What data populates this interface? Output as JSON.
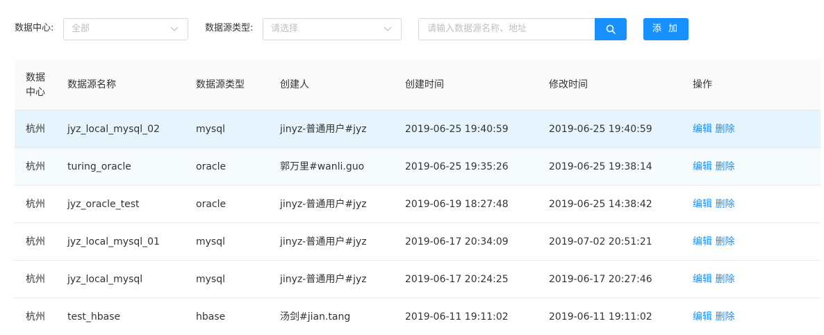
{
  "filters": {
    "datacenter_label": "数据中心:",
    "datacenter_placeholder": "全部",
    "type_label": "数据源类型:",
    "type_placeholder": "请选择",
    "search_placeholder": "请输入数据源名称、地址",
    "add_label": "添 加"
  },
  "icons": {
    "chevron": "chevron-down-icon",
    "search": "search-icon"
  },
  "colors": {
    "primary": "#1890ff",
    "selected_row": "#e6f4fd",
    "header_bg": "#fafafa"
  },
  "table": {
    "columns": [
      "数据中心",
      "数据源名称",
      "数据源类型",
      "创建人",
      "创建时间",
      "修改时间",
      "操作"
    ],
    "rows": [
      {
        "center": "杭州",
        "name": "jyz_local_mysql_02",
        "type": "mysql",
        "creator": "jinyz-普通用户#jyz",
        "created": "2019-06-25 19:40:59",
        "modified": "2019-06-25 19:40:59",
        "edit": "编辑",
        "del": "删除"
      },
      {
        "center": "杭州",
        "name": "turing_oracle",
        "type": "oracle",
        "creator": "郭万里#wanli.guo",
        "created": "2019-06-25 19:35:26",
        "modified": "2019-06-25 19:38:14",
        "edit": "编辑",
        "del": "删除"
      },
      {
        "center": "杭州",
        "name": "jyz_oracle_test",
        "type": "oracle",
        "creator": "jinyz-普通用户#jyz",
        "created": "2019-06-19 18:27:48",
        "modified": "2019-06-25 14:38:42",
        "edit": "编辑",
        "del": "删除"
      },
      {
        "center": "杭州",
        "name": "jyz_local_mysql_01",
        "type": "mysql",
        "creator": "jinyz-普通用户#jyz",
        "created": "2019-06-17 20:34:09",
        "modified": "2019-07-02 20:51:21",
        "edit": "编辑",
        "del": "删除"
      },
      {
        "center": "杭州",
        "name": "jyz_local_mysql",
        "type": "mysql",
        "creator": "jinyz-普通用户#jyz",
        "created": "2019-06-17 20:24:25",
        "modified": "2019-06-17 20:27:46",
        "edit": "编辑",
        "del": "删除"
      },
      {
        "center": "杭州",
        "name": "test_hbase",
        "type": "hbase",
        "creator": "汤剑#jian.tang",
        "created": "2019-06-11 19:11:02",
        "modified": "2019-06-11 19:11:02",
        "edit": "编辑",
        "del": "删除"
      }
    ]
  }
}
